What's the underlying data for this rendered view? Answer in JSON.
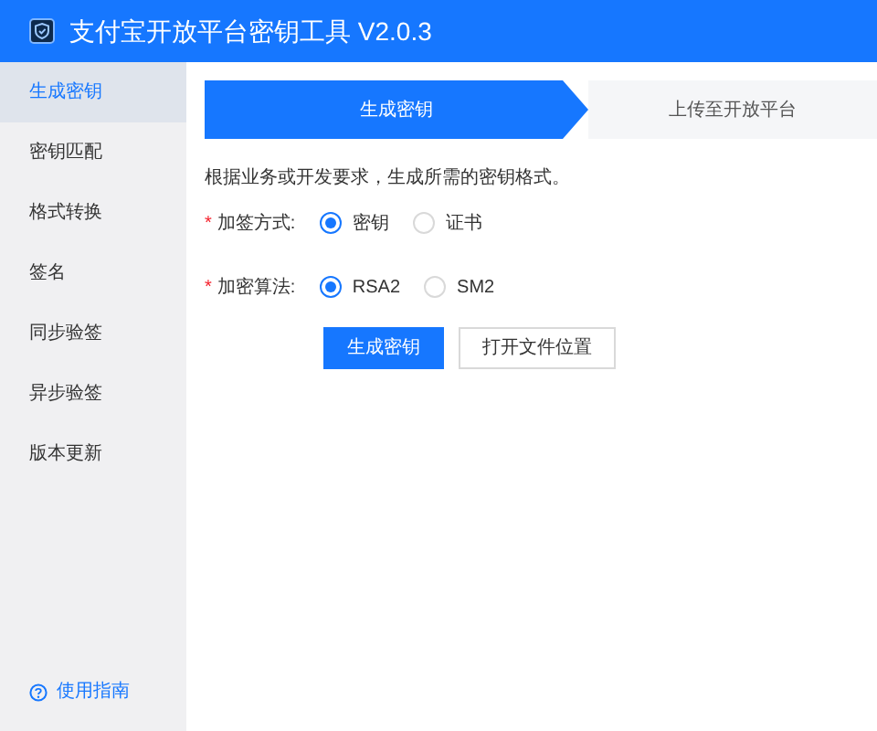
{
  "window": {
    "title": "支付宝开放平台密钥工具 V2.0.3"
  },
  "sidebar": {
    "items": [
      {
        "label": "生成密钥",
        "selected": true
      },
      {
        "label": "密钥匹配",
        "selected": false
      },
      {
        "label": "格式转换",
        "selected": false
      },
      {
        "label": "签名",
        "selected": false
      },
      {
        "label": "同步验签",
        "selected": false
      },
      {
        "label": "异步验签",
        "selected": false
      },
      {
        "label": "版本更新",
        "selected": false
      }
    ],
    "help_link": "使用指南"
  },
  "steps": [
    {
      "label": "生成密钥",
      "selected": true
    },
    {
      "label": "上传至开放平台",
      "selected": false
    }
  ],
  "description": "根据业务或开发要求，生成所需的密钥格式。",
  "fields": [
    {
      "label": "加签方式:",
      "required_mark": "*",
      "options": [
        {
          "label": "密钥",
          "selected": true
        },
        {
          "label": "证书",
          "selected": false
        }
      ]
    },
    {
      "label": "加密算法:",
      "required_mark": "*",
      "options": [
        {
          "label": "RSA2",
          "selected": true
        },
        {
          "label": "SM2",
          "selected": false
        }
      ]
    }
  ],
  "buttons": [
    {
      "label": "生成密钥",
      "kind": "primary"
    },
    {
      "label": "打开文件位置",
      "kind": "default"
    }
  ]
}
